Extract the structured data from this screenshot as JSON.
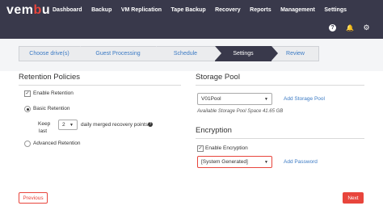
{
  "app": {
    "logo_main": "vem",
    "logo_accent": "b",
    "logo_end": "u"
  },
  "nav": [
    "Dashboard",
    "Backup",
    "VM Replication",
    "Tape Backup",
    "Recovery",
    "Reports",
    "Management",
    "Settings"
  ],
  "top_icons": {
    "help": "?",
    "bell": "🔔",
    "gear": "⚙"
  },
  "steps": [
    "Choose drive(s)",
    "Guest Processing",
    "Schedule",
    "Settings",
    "Review"
  ],
  "active_step": "Settings",
  "retention": {
    "title": "Retention Policies",
    "enable_label": "Enable Retention",
    "enable_checked": true,
    "basic_label": "Basic Retention",
    "keep_label_1": "Keep",
    "keep_label_2": "last",
    "keep_value": "2",
    "keep_suffix": "daily merged recovery points",
    "advanced_label": "Advanced Retention"
  },
  "storage": {
    "title": "Storage Pool",
    "pool_value": "V01Pool",
    "add_pool": "Add Storage Pool",
    "available": "Available Storage Pool Space 41.65 GB"
  },
  "encryption": {
    "title": "Encryption",
    "enable_label": "Enable Encryption",
    "enable_checked": true,
    "password_value": "[System Generated]",
    "add_password": "Add Password"
  },
  "footer": {
    "previous": "Previous",
    "next": "Next"
  },
  "colors": {
    "accent": "#e8453c",
    "dark": "#39394b",
    "link": "#3b7ac4"
  }
}
